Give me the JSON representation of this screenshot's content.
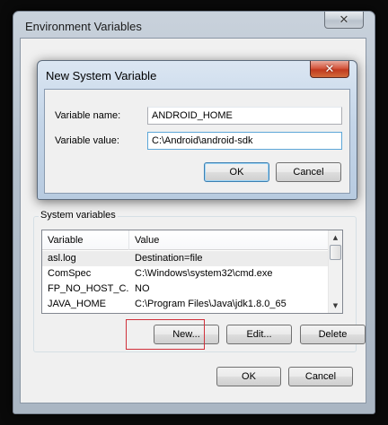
{
  "env_window": {
    "title": "Environment Variables",
    "close_symbol": "✕",
    "system_variables": {
      "group_title": "System variables",
      "columns": [
        "Variable",
        "Value"
      ],
      "rows": [
        {
          "variable": "asl.log",
          "value": "Destination=file"
        },
        {
          "variable": "ComSpec",
          "value": "C:\\Windows\\system32\\cmd.exe"
        },
        {
          "variable": "FP_NO_HOST_C...",
          "value": "NO"
        },
        {
          "variable": "JAVA_HOME",
          "value": "C:\\Program Files\\Java\\jdk1.8.0_65"
        }
      ],
      "buttons": {
        "new": "New...",
        "edit": "Edit...",
        "delete": "Delete"
      }
    },
    "ok_label": "OK",
    "cancel_label": "Cancel"
  },
  "new_var_dialog": {
    "title": "New System Variable",
    "close_symbol": "✕",
    "name_label": "Variable name:",
    "name_value": "ANDROID_HOME",
    "value_label": "Variable value:",
    "value_value": "C:\\Android\\android-sdk",
    "ok_label": "OK",
    "cancel_label": "Cancel"
  },
  "icons": {
    "scroll_up": "▲",
    "scroll_down": "▼"
  },
  "colors": {
    "highlight_box": "#d0303a",
    "close_button": "#c13a1f"
  }
}
